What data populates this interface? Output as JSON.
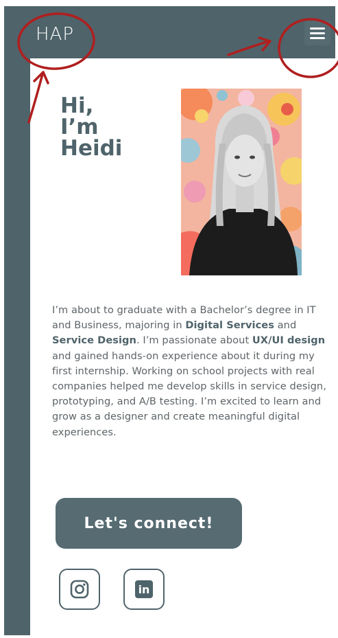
{
  "header": {
    "logo": "HAP",
    "menu_icon": "hamburger-menu-icon"
  },
  "hero": {
    "greeting_lines": [
      "Hi,",
      "I’m",
      "Heidi"
    ],
    "portrait_alt": "Heidi"
  },
  "bio": {
    "segments": [
      {
        "text": "I’m about to graduate with a Bachelor’s degree in IT and Business, majoring in "
      },
      {
        "text": "Digital Services"
      },
      {
        "text": " and "
      },
      {
        "text": "Service Design"
      },
      {
        "text": ". I’m passionate about "
      },
      {
        "text": "UX/UI design"
      },
      {
        "text": " and gained hands-on experience about it during my first internship. Working on school projects with real companies helped me develop skills in service design, prototyping, and A/B testing. I’m excited to learn and grow as a designer and create meaningful digital experiences."
      }
    ]
  },
  "cta": {
    "label": "Let's connect!"
  },
  "social": {
    "instagram_icon": "instagram-icon",
    "linkedin_icon": "linkedin-icon",
    "linkedin_text": "in"
  },
  "colors": {
    "primary": "#4f636a",
    "text": "#5e6468",
    "annotation": "#b01f1f"
  }
}
